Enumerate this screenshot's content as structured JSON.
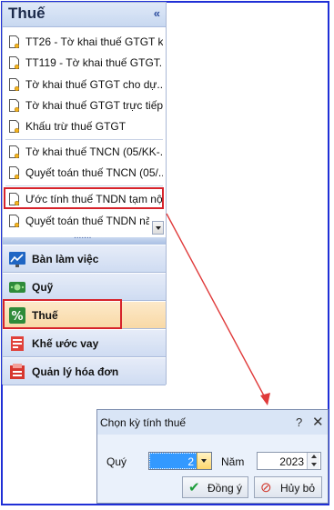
{
  "panel": {
    "title": "Thuế",
    "collapse": "«",
    "items": [
      {
        "label": "TT26 - Tờ khai thuế GTGT k..."
      },
      {
        "label": "TT119 - Tờ khai thuế GTGT..."
      },
      {
        "label": "Tờ khai thuế GTGT cho dự..."
      },
      {
        "label": "Tờ khai thuế GTGT trực tiếp..."
      },
      {
        "label": "Khấu trừ thuế GTGT"
      },
      {
        "label": "Tờ khai thuế TNCN (05/KK-..."
      },
      {
        "label": "Quyết toán thuế TNCN (05/..."
      },
      {
        "label": "Ước tính thuế TNDN tạm nộp"
      },
      {
        "label": "Quyết toán thuế TNDN năm"
      }
    ]
  },
  "nav": [
    {
      "label": "Bàn làm việc",
      "icon": "chart-board-icon"
    },
    {
      "label": "Quỹ",
      "icon": "money-icon"
    },
    {
      "label": "Thuế",
      "icon": "percent-icon",
      "selected": true
    },
    {
      "label": "Khế ước vay",
      "icon": "loan-icon"
    },
    {
      "label": "Quản lý hóa đơn",
      "icon": "invoice-icon"
    }
  ],
  "dialog": {
    "title": "Chọn kỳ tính thuế",
    "help": "?",
    "close": "✕",
    "quarter_label": "Quý",
    "quarter_value": "2",
    "year_label": "Năm",
    "year_value": "2023",
    "ok_label": "Đồng ý",
    "cancel_label": "Hủy bỏ"
  },
  "colors": {
    "frame": "#1f2fd6",
    "highlight": "#d6232b",
    "selection": "#3399ff",
    "selected_nav": "#f8d9a6"
  }
}
